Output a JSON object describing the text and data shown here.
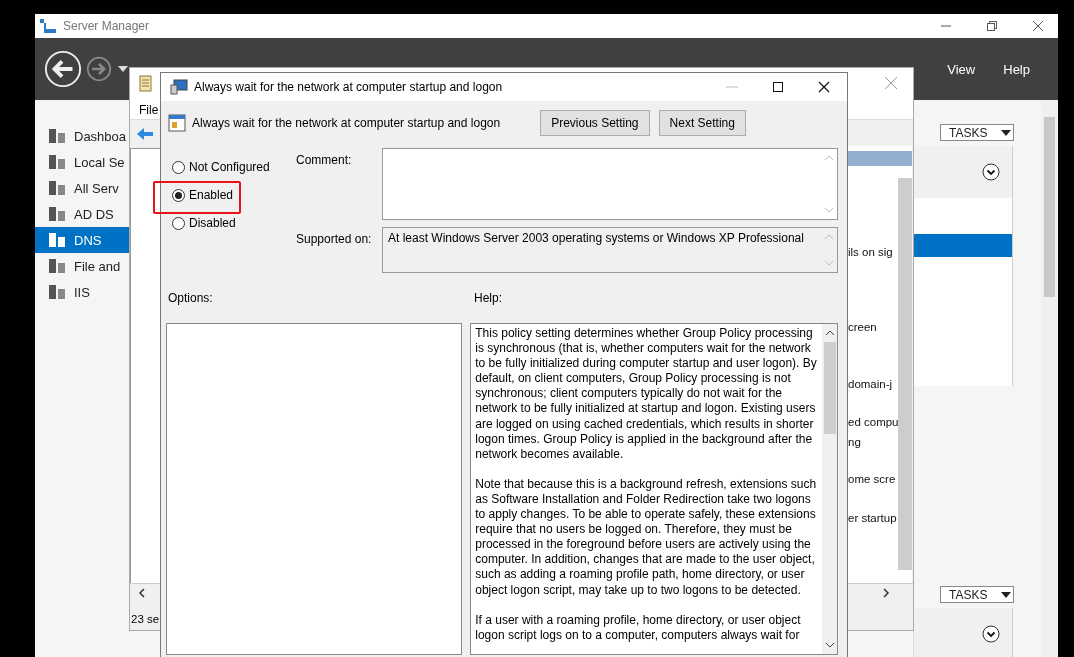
{
  "server_manager": {
    "title": "Server Manager",
    "menu": [
      "View",
      "Help"
    ],
    "sidebar": [
      {
        "label": "Dashboa",
        "selected": false
      },
      {
        "label": "Local Se",
        "selected": false
      },
      {
        "label": "All Serv",
        "selected": false
      },
      {
        "label": "AD DS",
        "selected": false
      },
      {
        "label": "DNS",
        "selected": true
      },
      {
        "label": "File and",
        "selected": false
      },
      {
        "label": "IIS",
        "selected": false
      }
    ],
    "tasks_buttons": [
      "TASKS",
      "TASKS"
    ]
  },
  "gpme": {
    "menu": [
      "File"
    ],
    "list_rows": [
      "ils on sig",
      "creen",
      "domain-j",
      "ed compu",
      "ng",
      "ome scre",
      "er startup"
    ],
    "status": "23 se"
  },
  "dialog": {
    "title": "Always wait for the network at computer startup and logon",
    "setting_name": "Always wait for the network at computer startup and logon",
    "buttons": [
      "Previous Setting",
      "Next Setting"
    ],
    "options": [
      {
        "label": "Not Configured",
        "selected": false
      },
      {
        "label": "Enabled",
        "selected": true
      },
      {
        "label": "Disabled",
        "selected": false
      }
    ],
    "comment_label": "Comment:",
    "supported_label": "Supported on:",
    "supported_text": "At least Windows Server 2003 operating systems or Windows XP Professional",
    "options_label": "Options:",
    "help_label": "Help:",
    "help": [
      "This policy setting determines whether Group Policy processing is synchronous (that is, whether computers wait for the network to be fully initialized during computer startup and user logon). By default, on client computers, Group Policy processing is not synchronous; client computers typically do not wait for the network to be fully initialized at startup and logon. Existing users are logged on using cached credentials, which results in shorter logon times. Group Policy is applied in the background after the network becomes available.",
      "Note that because this is a background refresh, extensions such as Software Installation and Folder Redirection take two logons to apply changes. To be able to operate safely, these extensions require that no users be logged on. Therefore, they must be processed in the foreground before users are actively using the computer. In addition, changes that are made to the user object, such as adding a roaming profile path, home directory, or user object logon script, may take up to two logons to be detected.",
      "If a user with a roaming profile, home directory, or user object logon script logs on to a computer, computers always wait for"
    ]
  }
}
